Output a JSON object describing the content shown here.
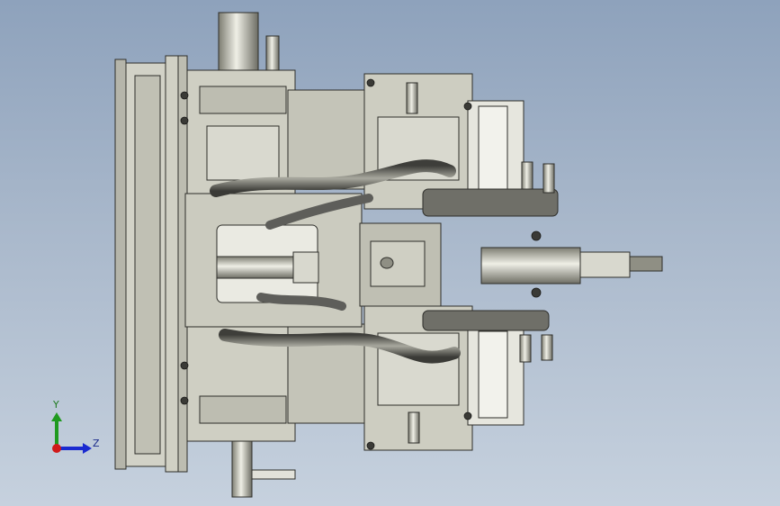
{
  "viewport": {
    "background_top": "#8ea2bc",
    "background_bottom": "#c6d1de",
    "model_name": "cad-fixture-assembly",
    "part_color": "#c9c9bd",
    "edge_color": "#2e2e2a",
    "shadow_color": "#8f8f84",
    "hose_color": "#5e5e5a",
    "handle_color": "#e2e2da"
  },
  "triad": {
    "y_label": "Y",
    "z_label": "Z",
    "y_color": "#1f9a1f",
    "z_color": "#1a2ad0",
    "x_color": "#d01a1a"
  }
}
